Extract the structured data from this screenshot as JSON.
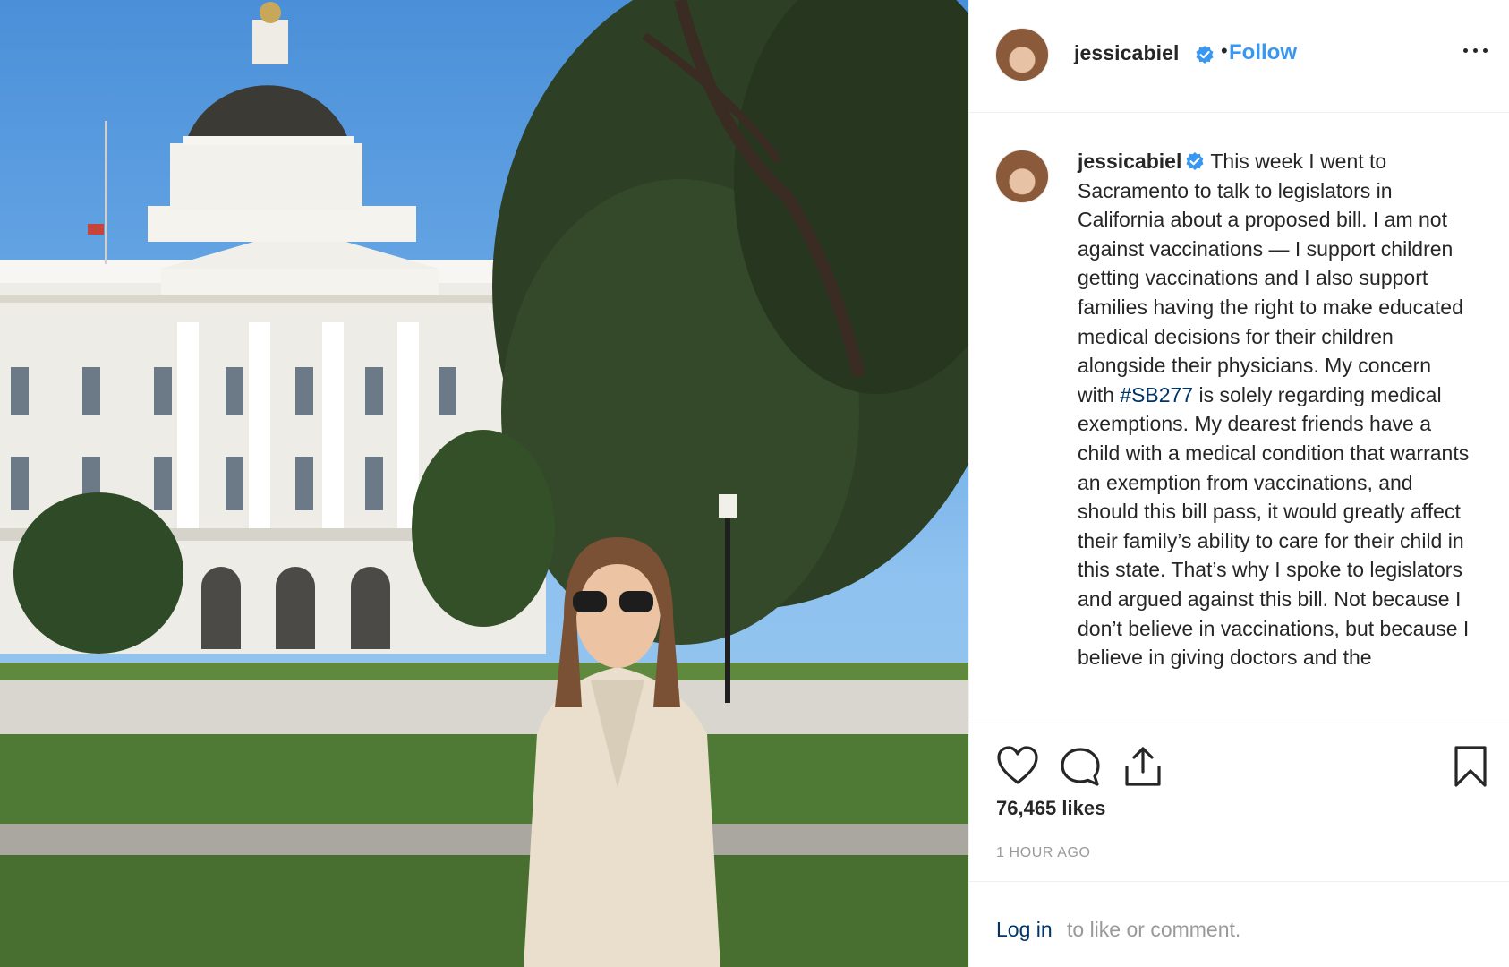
{
  "post": {
    "username": "jessicabiel",
    "follow_label": "Follow",
    "separator": "•",
    "caption_before_tag": "This week I went to Sacramento to talk to legislators in California about a proposed bill. I am not against vaccinations — I support children getting vaccinations and I also support families having the right to make educated medical decisions for their children alongside their physicians. My concern with ",
    "hashtag": "#SB277",
    "caption_after_tag": " is solely regarding medical exemptions. My dearest friends have a child with a medical condition that warrants an exemption from vaccinations, and should this bill pass, it would greatly affect their family’s ability to care for their child in this state. That’s why I spoke to legislators and argued against this bill. Not because I don’t believe in vaccinations, but because I believe in giving doctors and the",
    "likes": "76,465 likes",
    "timestamp": "1 HOUR AGO",
    "login_link": "Log in",
    "login_rest": "to like or comment."
  },
  "icons": {
    "verified": "verified-badge-icon",
    "like": "heart-icon",
    "comment": "comment-bubble-icon",
    "share": "share-upload-icon",
    "save": "bookmark-icon",
    "more": "more-options-icon"
  },
  "colors": {
    "link_blue": "#3897f0",
    "hashtag_blue": "#003569",
    "text": "#262626",
    "muted": "#999999",
    "divider": "#efefef"
  }
}
